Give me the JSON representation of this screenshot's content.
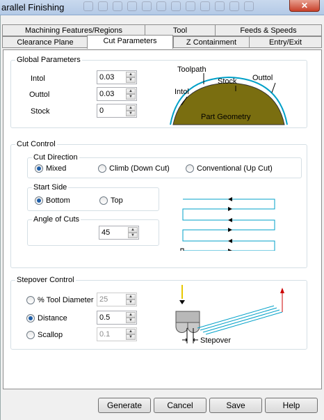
{
  "window": {
    "title": "arallel Finishing",
    "close_glyph": "✕"
  },
  "tabs_row1": [
    "Machining Features/Regions",
    "Tool",
    "Feeds & Speeds"
  ],
  "tabs_row2": [
    "Clearance Plane",
    "Cut Parameters",
    "Z Containment",
    "Entry/Exit"
  ],
  "global": {
    "title": "Global Parameters",
    "intol_label": "Intol",
    "intol_value": "0.03",
    "outtol_label": "Outtol",
    "outtol_value": "0.03",
    "stock_label": "Stock",
    "stock_value": "0",
    "diagram": {
      "toolpath": "Toolpath",
      "stock": "Stock",
      "outtol": "Outtol",
      "intol": "Intol",
      "part": "Part Geometry",
      "part_color": "#7a6e10",
      "path_color": "#00a0c8"
    }
  },
  "cut_control": {
    "title": "Cut Control",
    "direction_title": "Cut Direction",
    "mixed": "Mixed",
    "climb": "Climb (Down Cut)",
    "conventional": "Conventional (Up Cut)",
    "start_title": "Start Side",
    "bottom": "Bottom",
    "top": "Top",
    "angle_title": "Angle of Cuts",
    "angle_value": "45"
  },
  "stepover": {
    "title": "Stepover Control",
    "tool_diameter": "% Tool Diameter",
    "tool_diameter_value": "25",
    "distance": "Distance",
    "distance_value": "0.5",
    "scallop": "Scallop",
    "scallop_value": "0.1",
    "diagram_label": "Stepover"
  },
  "buttons": {
    "generate": "Generate",
    "cancel": "Cancel",
    "save": "Save",
    "help": "Help"
  }
}
